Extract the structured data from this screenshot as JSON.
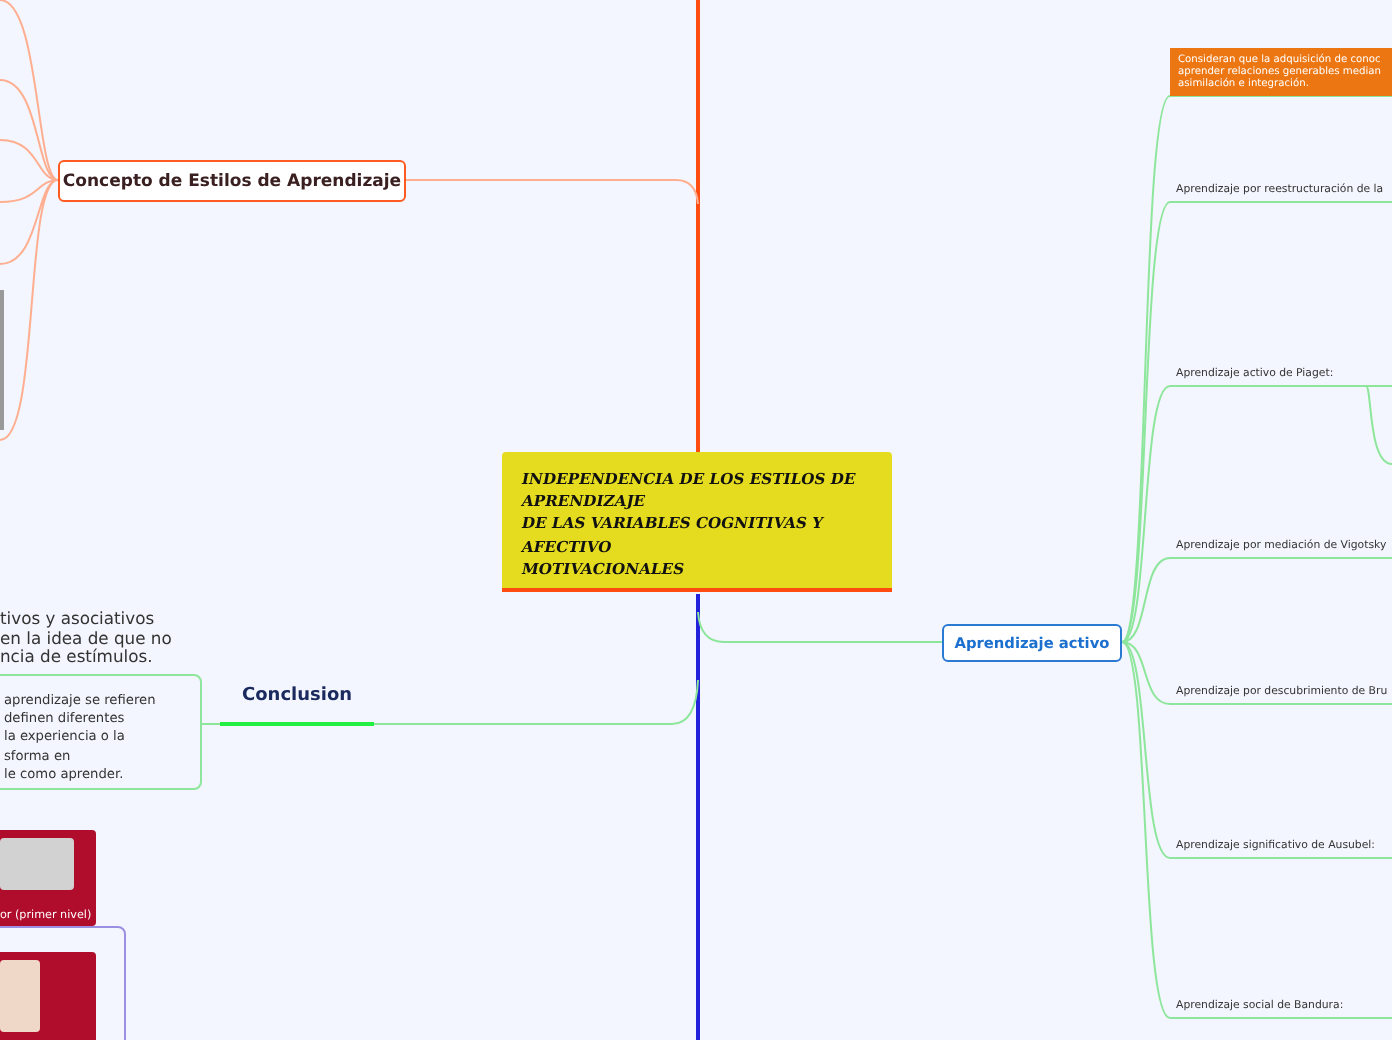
{
  "central_topic": {
    "lines": [
      "INDEPENDENCIA DE LOS ESTILOS DE",
      "APRENDIZAJE",
      "DE LAS VARIABLES COGNITIVAS Y",
      "AFECTIVO",
      "MOTIVACIONALES"
    ]
  },
  "concept_branch": {
    "label": "Concepto de Estilos de Aprendizaje"
  },
  "active_branch": {
    "label": "Aprendizaje activo",
    "children": [
      {
        "kind": "note",
        "lines": [
          "Consideran que la adquisición de conoc",
          "aprender relaciones generables median",
          "asimilación e integración."
        ]
      },
      {
        "kind": "topic",
        "label": "Aprendizaje por reestructuración de la"
      },
      {
        "kind": "topic",
        "label": "Aprendizaje activo de Piaget:"
      },
      {
        "kind": "topic",
        "label": "Aprendizaje por mediación de Vigotsky"
      },
      {
        "kind": "topic",
        "label": "Aprendizaje por descubrimiento de Bru"
      },
      {
        "kind": "topic",
        "label": "Aprendizaje significativo de Ausubel:"
      },
      {
        "kind": "topic",
        "label": "Aprendizaje social de Bandura:"
      }
    ]
  },
  "conclusion_branch": {
    "label": "Conclusion",
    "note_lines": [
      "aprendizaje se refieren",
      "definen diferentes",
      "la experiencia o la",
      "sforma en",
      "le como aprender."
    ]
  },
  "floating_text": {
    "lines": [
      "tivos y asociativos",
      "en la idea de que no",
      "ncia de estímulos."
    ]
  },
  "image_cards": [
    {
      "kind": "captioned",
      "caption": "or (primer nivel)"
    },
    {
      "kind": "photo"
    }
  ]
}
